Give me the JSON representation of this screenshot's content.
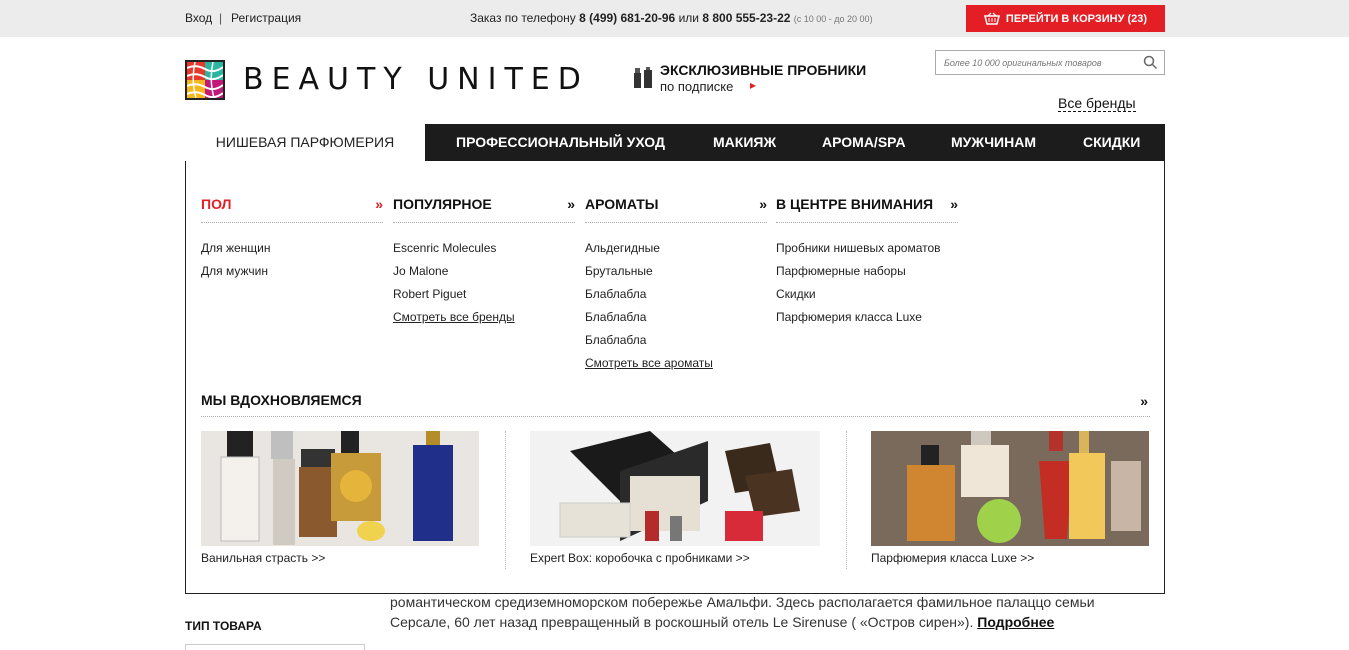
{
  "topbar": {
    "login": "Вход",
    "separator": "|",
    "register": "Регистрация",
    "order_prefix": "Заказ по телефону",
    "phone1": "8 (499) 681-20-96",
    "or": "или",
    "phone2": "8 800 555-23-22",
    "hours": "(с 10 00 - до 20 00)",
    "cart_label": "ПЕРЕЙТИ В КОРЗИНУ (23)"
  },
  "header": {
    "logo_text": "BEAUTY UNITED",
    "samples_title": "ЭКСКЛЮЗИВНЫЕ ПРОБНИКИ",
    "samples_sub": "по подписке",
    "search_placeholder": "Более 10 000 оригинальных товаров",
    "all_brands": "Все бренды"
  },
  "menu": {
    "items": [
      {
        "label": "НИШЕВАЯ ПАРФЮМЕРИЯ",
        "active": true
      },
      {
        "label": "ПРОФЕССИОНАЛЬНЫЙ УХОД"
      },
      {
        "label": "МАКИЯЖ"
      },
      {
        "label": "АРОМА/SPA"
      },
      {
        "label": "МУЖЧИНАМ"
      },
      {
        "label": "СКИДКИ"
      }
    ]
  },
  "dropdown": {
    "columns": [
      {
        "title": "ПОЛ",
        "arrow": "»",
        "links": [
          "Для женщин",
          "Для мужчин"
        ]
      },
      {
        "title": "ПОПУЛЯРНОЕ",
        "arrow": "»",
        "links": [
          "Escenric Molecules",
          "Jo Malone",
          "Robert Piguet",
          "Смотреть все бренды"
        ]
      },
      {
        "title": "АРОМАТЫ",
        "arrow": "»",
        "links": [
          "Альдегидные",
          "Брутальные",
          "Блаблабла",
          "Блаблабла",
          "Блаблабла",
          "Смотреть все ароматы"
        ]
      },
      {
        "title": "В ЦЕНТРЕ ВНИМАНИЯ",
        "arrow": "»",
        "links": [
          "Пробники нишевых ароматов",
          "Парфюмерные наборы",
          "Скидки",
          "Парфюмерия класса Luxe"
        ]
      }
    ],
    "inspired_title": "МЫ ВДОХНОВЛЯЕМСЯ",
    "inspired_arrow": "»",
    "cards": [
      {
        "caption": "Ванильная страсть >>"
      },
      {
        "caption": "Expert Box: коробочка с пробниками >>"
      },
      {
        "caption": "Парфюмерия класса Luxe >>"
      }
    ]
  },
  "content": {
    "line1": "романтическом средиземноморском побережье Амальфи. Здесь располагается фамильное палаццо семьи",
    "line2": "Серсале, 60 лет назад превращенный в роскошный отель Le Sirenuse ( «Остров сирен»).",
    "more": "Подробнее",
    "type_label": "ТИП ТОВАРА"
  },
  "colors": {
    "accent": "#e31e24",
    "menu_bg": "#1c1c1c",
    "topbar_bg": "#ececec"
  }
}
